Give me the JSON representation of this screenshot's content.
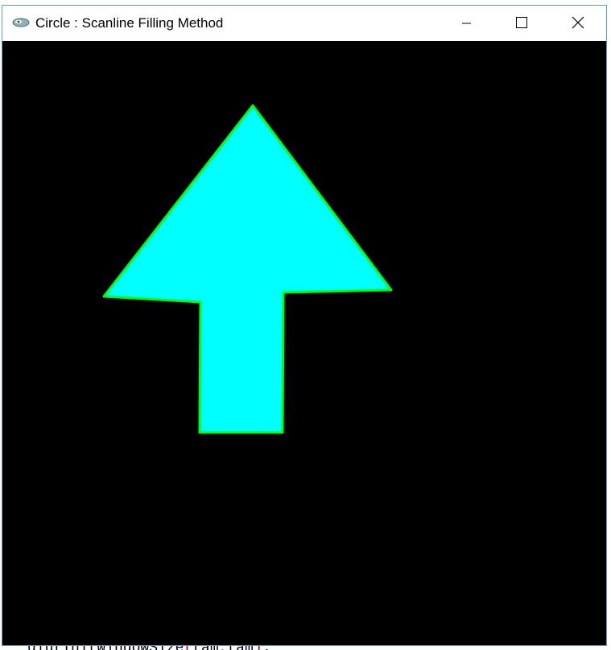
{
  "window": {
    "title": "Circle : Scanline Filling Method"
  },
  "titlebar_buttons": {
    "minimize_icon": "minimize-icon",
    "maximize_icon": "maximize-icon",
    "close_icon": "close-icon"
  },
  "canvas": {
    "background_color": "#000000",
    "fill_color": "#00ffff",
    "outline_color": "#00ff00",
    "shape": "arrow-up-polygon"
  },
  "background_code": {
    "text_start": "glutInitWindowSize",
    "open_paren": "(",
    "args": "tam,tam",
    "close_paren": ")",
    "end": ";"
  }
}
